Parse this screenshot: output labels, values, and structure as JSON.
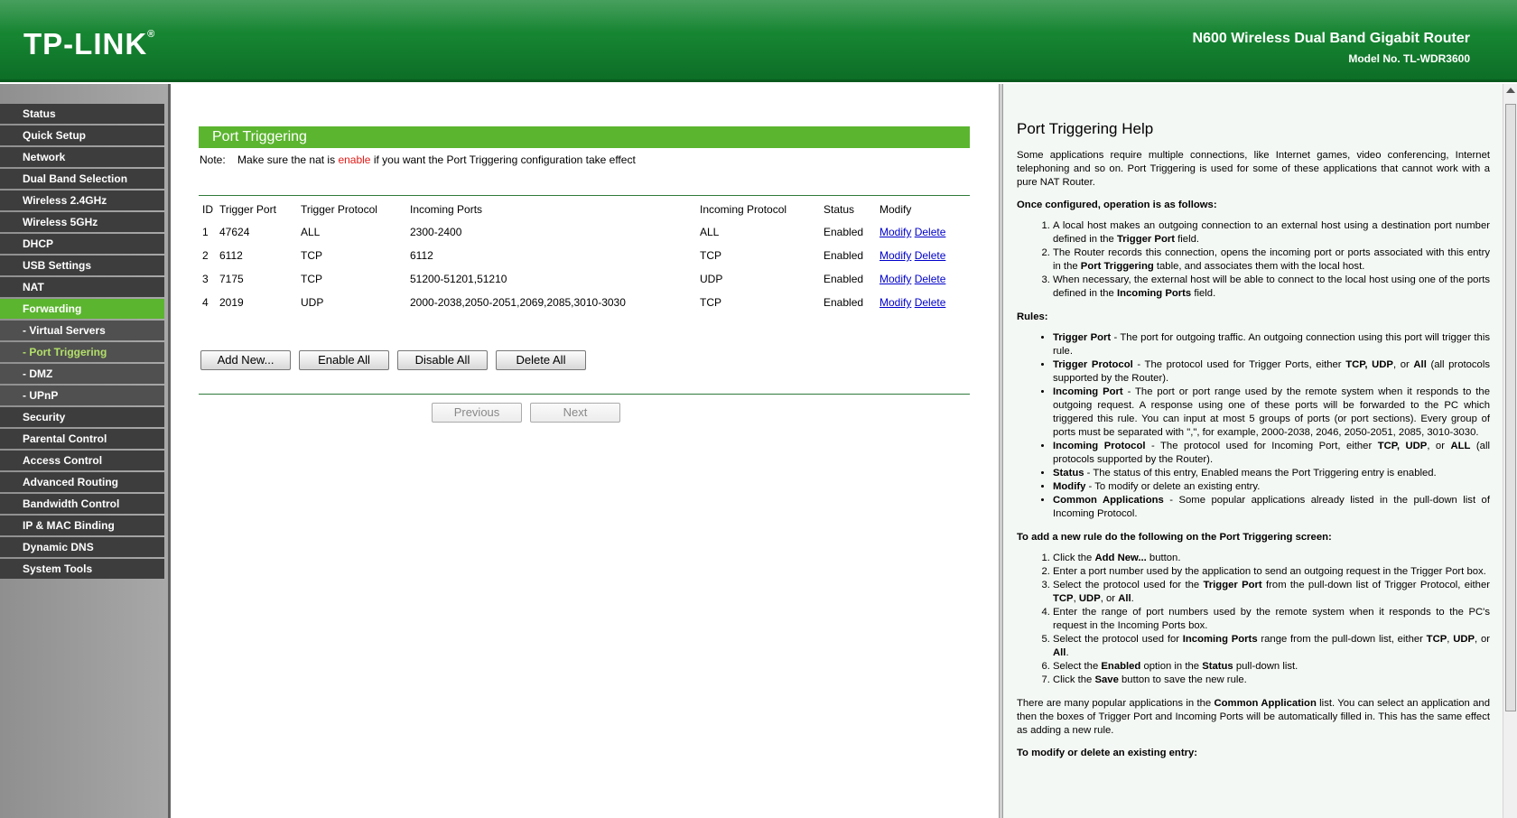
{
  "header": {
    "logo": "TP-LINK",
    "logo_mark": "®",
    "product": "N600 Wireless Dual Band Gigabit Router",
    "model": "Model No. TL-WDR3600"
  },
  "menu": [
    "Status",
    "Quick Setup",
    "Network",
    "Dual Band Selection",
    "Wireless 2.4GHz",
    "Wireless 5GHz",
    "DHCP",
    "USB Settings",
    "NAT",
    "Forwarding",
    "- Virtual Servers",
    "- Port Triggering",
    "- DMZ",
    "- UPnP",
    "Security",
    "Parental Control",
    "Access Control",
    "Advanced Routing",
    "Bandwidth Control",
    "IP & MAC Binding",
    "Dynamic DNS",
    "System Tools"
  ],
  "main": {
    "title": "Port Triggering",
    "note_prefix": "Note:",
    "note_pre": "Make sure the nat is",
    "note_highlight": "enable",
    "note_post": "if you want the Port Triggering configuration take effect",
    "columns": [
      "ID",
      "Trigger Port",
      "Trigger Protocol",
      "Incoming Ports",
      "Incoming Protocol",
      "Status",
      "Modify"
    ],
    "rows": [
      [
        "1",
        "47624",
        "ALL",
        "2300-2400",
        "ALL",
        "Enabled"
      ],
      [
        "2",
        "6112",
        "TCP",
        "6112",
        "TCP",
        "Enabled"
      ],
      [
        "3",
        "7175",
        "TCP",
        "51200-51201,51210",
        "UDP",
        "Enabled"
      ],
      [
        "4",
        "2019",
        "UDP",
        "2000-2038,2050-2051,2069,2085,3010-3030",
        "TCP",
        "Enabled"
      ]
    ],
    "modify_label": "Modify",
    "delete_label": "Delete",
    "buttons": {
      "add_new": "Add New...",
      "enable_all": "Enable All",
      "disable_all": "Disable All",
      "delete_all": "Delete All",
      "previous": "Previous",
      "next": "Next"
    }
  },
  "help": {
    "title": "Port Triggering Help",
    "intro": "Some applications require multiple connections, like Internet games, video conferencing, Internet telephoning and so on. Port Triggering is used for some of these applications that cannot work with a pure NAT Router.",
    "once_heading": "Once configured, operation is as follows:",
    "once_1a": "A local host makes an outgoing connection to an external host using a destination port number defined in the ",
    "once_1b": "Trigger Port",
    "once_1c": " field.",
    "once_2a": "The Router records this connection, opens the incoming port or ports associated with this entry in the ",
    "once_2b": "Port Triggering",
    "once_2c": " table, and associates them with the local host.",
    "once_3a": "When necessary, the external host will be able to connect to the local host using one of the ports defined in the ",
    "once_3b": "Incoming Ports",
    "once_3c": " field.",
    "rules_heading": "Rules:",
    "r1b": "Trigger Port",
    "r1": " - The port for outgoing traffic. An outgoing connection using this port will trigger this rule.",
    "r2b": "Trigger Protocol",
    "r2a": " - The protocol used for Trigger Ports, either ",
    "r2tcp": "TCP, UDP",
    "r2or": ", or ",
    "r2all": "All",
    "r2c": " (all protocols supported by the Router).",
    "r3b": "Incoming Port",
    "r3": " - The port or port range used by the remote system when it responds to the outgoing request. A response using one of these ports will be forwarded to the PC which triggered this rule. You can input at most 5 groups of ports (or port sections). Every group of ports must be separated with \",\", for example, 2000-2038, 2046, 2050-2051, 2085, 3010-3030.",
    "r4b": "Incoming Protocol",
    "r4a": " - The protocol used for Incoming Port, either ",
    "r4tcp": "TCP, UDP",
    "r4or": ", or ",
    "r4all": "ALL",
    "r4c": " (all protocols supported by the Router).",
    "r5b": "Status",
    "r5": " - The status of this entry, Enabled means the Port Triggering entry is enabled.",
    "r6b": "Modify",
    "r6": " - To modify or delete an existing entry.",
    "r7b": "Common Applications",
    "r7": " - Some popular applications already listed in the pull-down list of Incoming Protocol.",
    "add_heading": "To add a new rule do the following on the Port Triggering screen:",
    "a1a": "Click the ",
    "a1b": "Add New...",
    "a1c": " button.",
    "a2": "Enter a port number used by the application to send an outgoing request in the Trigger Port box.",
    "a3a": "Select the protocol used for the ",
    "a3b": "Trigger Port",
    "a3c": " from the pull-down list of Trigger Protocol, either ",
    "a3tcp": "TCP",
    "a3s": ", ",
    "a3udp": "UDP",
    "a3or": ", or ",
    "a3all": "All",
    "a3d": ".",
    "a4": "Enter the range of port numbers used by the remote system when it responds to the PC's request in the Incoming Ports box.",
    "a5a": "Select the protocol used for ",
    "a5b": "Incoming Ports",
    "a5c": " range from the pull-down list, either ",
    "a5tcp": "TCP",
    "a5s": ", ",
    "a5udp": "UDP",
    "a5or": ", or ",
    "a5all": "All",
    "a5d": ".",
    "a6a": "Select the ",
    "a6b": "Enabled",
    "a6c": " option in the ",
    "a6d": "Status",
    "a6e": " pull-down list.",
    "a7a": "Click the ",
    "a7b": "Save",
    "a7c": " button to save the new rule.",
    "common_a": "There are many popular applications in the ",
    "common_b": "Common Application",
    "common_c": " list. You can select an application and then the boxes of Trigger Port and Incoming Ports will be automatically filled in. This has the same effect as adding a new rule.",
    "modify_heading": "To modify or delete an existing entry:"
  }
}
